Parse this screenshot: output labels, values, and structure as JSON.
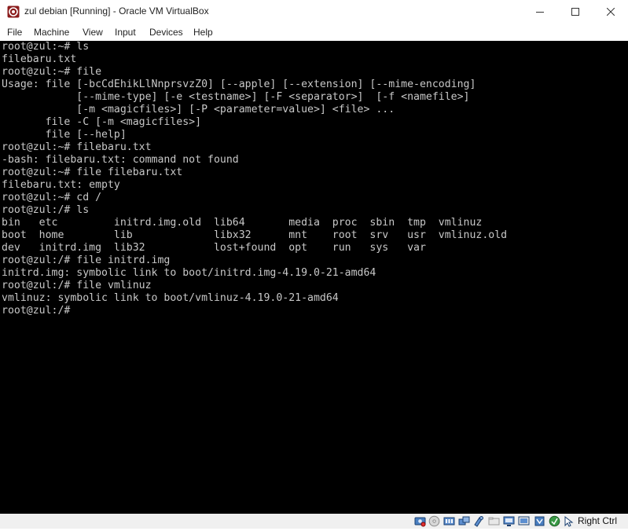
{
  "window": {
    "title": "zul debian [Running] - Oracle VM VirtualBox"
  },
  "menu": [
    "File",
    "Machine",
    "View",
    "Input",
    "Devices",
    "Help"
  ],
  "terminal": {
    "lines": [
      "root@zul:~# ls",
      "filebaru.txt",
      "root@zul:~# file",
      "Usage: file [-bcCdEhikLlNnprsvzZ0] [--apple] [--extension] [--mime-encoding]",
      "            [--mime-type] [-e <testname>] [-F <separator>]  [-f <namefile>]",
      "            [-m <magicfiles>] [-P <parameter=value>] <file> ...",
      "       file -C [-m <magicfiles>]",
      "       file [--help]",
      "root@zul:~# filebaru.txt",
      "-bash: filebaru.txt: command not found",
      "root@zul:~# file filebaru.txt",
      "filebaru.txt: empty",
      "root@zul:~# cd /",
      "root@zul:/# ls",
      "bin   etc         initrd.img.old  lib64       media  proc  sbin  tmp  vmlinuz",
      "boot  home        lib             libx32      mnt    root  srv   usr  vmlinuz.old",
      "dev   initrd.img  lib32           lost+found  opt    run   sys   var",
      "root@zul:/# file initrd.img",
      "initrd.img: symbolic link to boot/initrd.img-4.19.0-21-amd64",
      "root@zul:/# file vmlinuz",
      "vmlinuz: symbolic link to boot/vmlinuz-4.19.0-21-amd64",
      "root@zul:/#"
    ]
  },
  "statusbar": {
    "icons": [
      "hard-disk-icon",
      "optical-drive-icon",
      "audio-icon",
      "network-icon",
      "usb-icon",
      "shared-folders-icon",
      "display-icon",
      "video-capture-icon",
      "cpu-icon",
      "guest-additions-icon",
      "mouse-integration-icon",
      "keyboard-icon"
    ],
    "host_key": "Right Ctrl"
  },
  "colors": {
    "terminal_bg": "#000000",
    "terminal_fg": "#c8c8c8",
    "vbox_blue": "#1a5fb4",
    "app_icon_red": "#c0392b"
  }
}
